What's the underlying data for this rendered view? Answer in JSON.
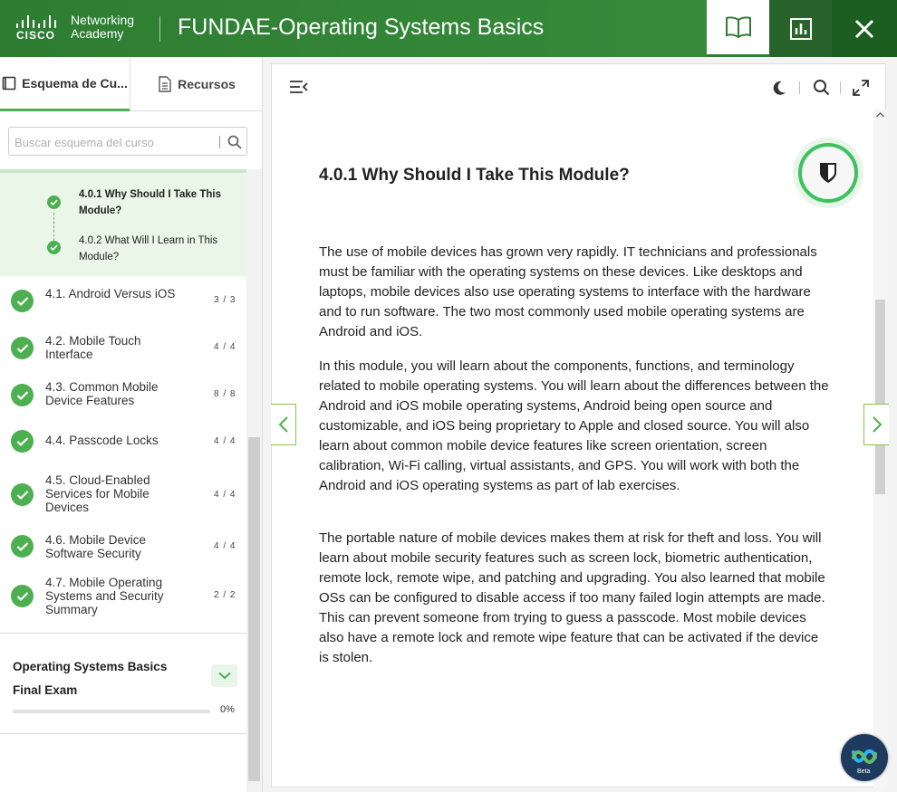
{
  "header": {
    "logo_brand": "CISCO",
    "logo_line1": "Networking",
    "logo_line2": "Academy",
    "title": "FUNDAE-Operating Systems Basics",
    "buttons": {
      "book_icon": "book-icon",
      "stats_icon": "bar-chart-icon",
      "close_icon": "close-icon"
    }
  },
  "sidebar": {
    "tabs": [
      {
        "label": "Esquema de Cu...",
        "icon": "book-outline-icon"
      },
      {
        "label": "Recursos",
        "icon": "document-icon"
      }
    ],
    "search": {
      "placeholder": "Buscar esquema del curso",
      "value": ""
    },
    "subitems": [
      {
        "label": "4.0.1 Why Should I Take This Module?"
      },
      {
        "label": "4.0.2 What Will I Learn in This Module?"
      }
    ],
    "items": [
      {
        "label": "4.1. Android Versus iOS",
        "count": "3 / 3"
      },
      {
        "label": "4.2. Mobile Touch Interface",
        "count": "4 / 4"
      },
      {
        "label": "4.3. Common Mobile Device Features",
        "count": "8 / 8"
      },
      {
        "label": "4.4. Passcode Locks",
        "count": "4 / 4"
      },
      {
        "label": "4.5. Cloud-Enabled Services for Mobile Devices",
        "count": "4 / 4"
      },
      {
        "label": "4.6. Mobile Device Software Security",
        "count": "4 / 4"
      },
      {
        "label": "4.7. Mobile Operating Systems and Security Summary",
        "count": "2 / 2"
      }
    ],
    "exam": {
      "title": "Operating Systems Basics Final Exam",
      "progress_label": "0%",
      "progress": 0
    }
  },
  "content": {
    "heading": "4.0.1 Why Should I Take This Module?",
    "paragraphs": [
      "The use of mobile devices has grown very rapidly. IT technicians and professionals must be familiar with the operating systems on these devices. Like desktops and laptops, mobile devices also use operating systems to interface with the hardware and to run software. The two most commonly used mobile operating systems are Android and iOS.",
      "In this module, you will learn about the components, functions, and terminology related to mobile operating systems. You will learn about the differences between the Android and iOS mobile operating systems, Android being open source and customizable, and iOS being proprietary to Apple and closed source. You will also learn about common mobile device features like screen orientation, screen calibration, Wi-Fi calling, virtual assistants, and GPS. You will work with both the Android and iOS operating systems as part of lab exercises.",
      "The portable nature of mobile devices makes them at risk for theft and loss. You will learn about mobile security features such as screen lock, biometric authentication, remote lock, remote wipe, and patching and upgrading. You also learned that mobile OSs can be configured to disable access if too many failed login attempts are made. This can prevent someone from trying to guess a passcode. Most mobile devices also have a remote lock and remote wipe feature that can be activated if the device is stolen."
    ],
    "toolbar_icons": [
      "collapse-menu-icon",
      "dark-mode-icon",
      "search-icon",
      "fullscreen-icon"
    ],
    "webex_badge": "Beta"
  },
  "colors": {
    "brand_green": "#2e7d32",
    "accent_green": "#4caf50"
  }
}
